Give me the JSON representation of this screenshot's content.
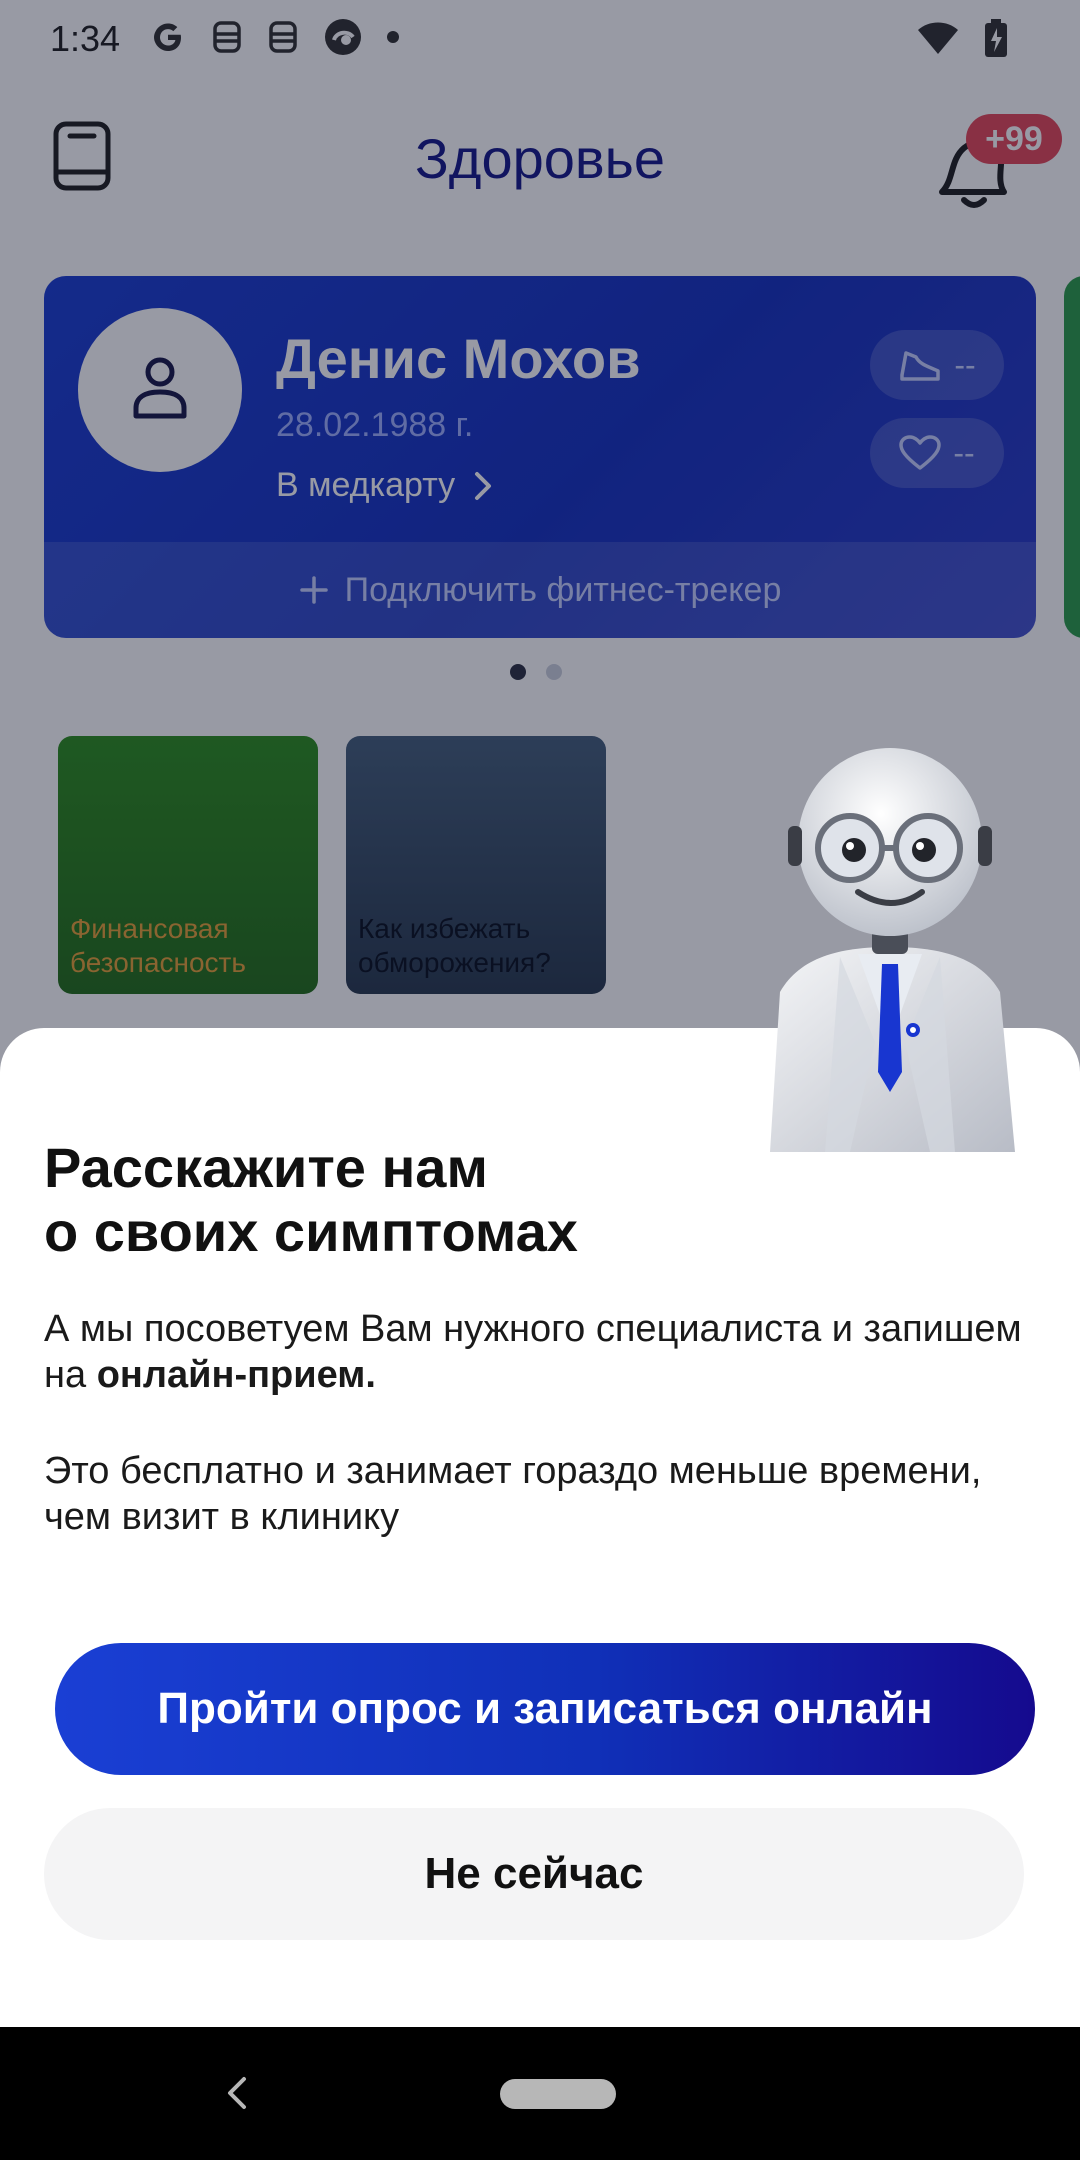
{
  "status_bar": {
    "time": "1:34",
    "notification_icons": [
      "google-icon",
      "robot-icon",
      "robot-icon",
      "browser-icon",
      "dot-icon"
    ],
    "right_icons": [
      "wifi-icon",
      "battery-charging-icon"
    ]
  },
  "app_bar": {
    "title": "Здоровье",
    "notification_badge": "+99"
  },
  "profile_card": {
    "name": "Денис Мохов",
    "birth_date": "28.02.1988 г.",
    "medcard_link": "В медкарту",
    "steps_value": "--",
    "pulse_value": "--",
    "connect_tracker": "Подключить фитнес-трекер",
    "pager_total": 2,
    "pager_active": 1
  },
  "stories": [
    {
      "label": "Финансовая безопасность"
    },
    {
      "label": "Как избежать обморожения?"
    }
  ],
  "sheet": {
    "title_line1": "Расскажите нам",
    "title_line2": "о своих симптомах",
    "text1_prefix": "А мы посоветуем Вам нужного специалиста и запишем на ",
    "text1_bold": "онлайн-прием.",
    "text2": "Это бесплатно и занимает гораздо меньше времени, чем визит в клинику",
    "primary_button": "Пройти опрос и записаться онлайн",
    "secondary_button": "Не сейчас"
  },
  "colors": {
    "brand_blue": "#1a3fd4",
    "brand_dark": "#150a8e",
    "badge_red": "#e6495a",
    "title_blue": "#171a8a"
  }
}
